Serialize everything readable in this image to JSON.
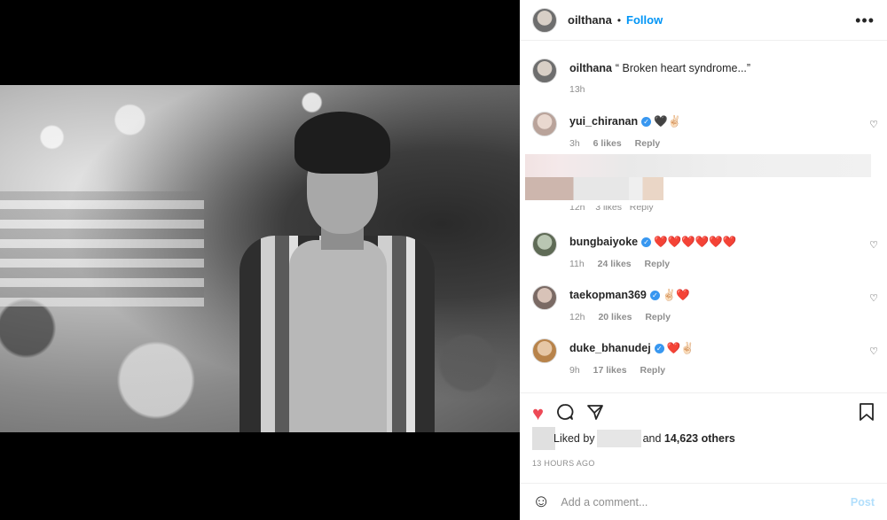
{
  "post": {
    "username": "oilthana",
    "dot": "•",
    "follow_label": "Follow",
    "more_icon": "more-horizontal-icon",
    "caption": "“ Broken heart syndrome...”",
    "caption_time": "13h"
  },
  "comments": [
    {
      "username": "yui_chiranan",
      "verified": true,
      "text": "🖤✌🏻",
      "time": "3h",
      "likes": "6 likes",
      "reply": "Reply"
    },
    {
      "username": "",
      "verified": false,
      "text": "",
      "time": "12h",
      "likes": "3 likes",
      "reply": "Reply",
      "obscured": true
    },
    {
      "username": "bungbaiyoke",
      "verified": true,
      "text": "❤️❤️❤️❤️❤️❤️",
      "time": "11h",
      "likes": "24 likes",
      "reply": "Reply"
    },
    {
      "username": "taekopman369",
      "verified": true,
      "text": "✌🏻❤️",
      "time": "12h",
      "likes": "20 likes",
      "reply": "Reply"
    },
    {
      "username": "duke_bhanudej",
      "verified": true,
      "text": "❤️✌🏻",
      "time": "9h",
      "likes": "17 likes",
      "reply": "Reply"
    }
  ],
  "actions": {
    "liked_by_prefix": "Liked by",
    "and": "and",
    "others_count": "14,623 others",
    "timestamp": "13 HOURS AGO"
  },
  "add_comment": {
    "placeholder": "Add a comment...",
    "post_label": "Post"
  },
  "colors": {
    "follow_blue": "#0095f6",
    "like_red": "#ed4956",
    "post_disabled": "#b2dffc"
  }
}
